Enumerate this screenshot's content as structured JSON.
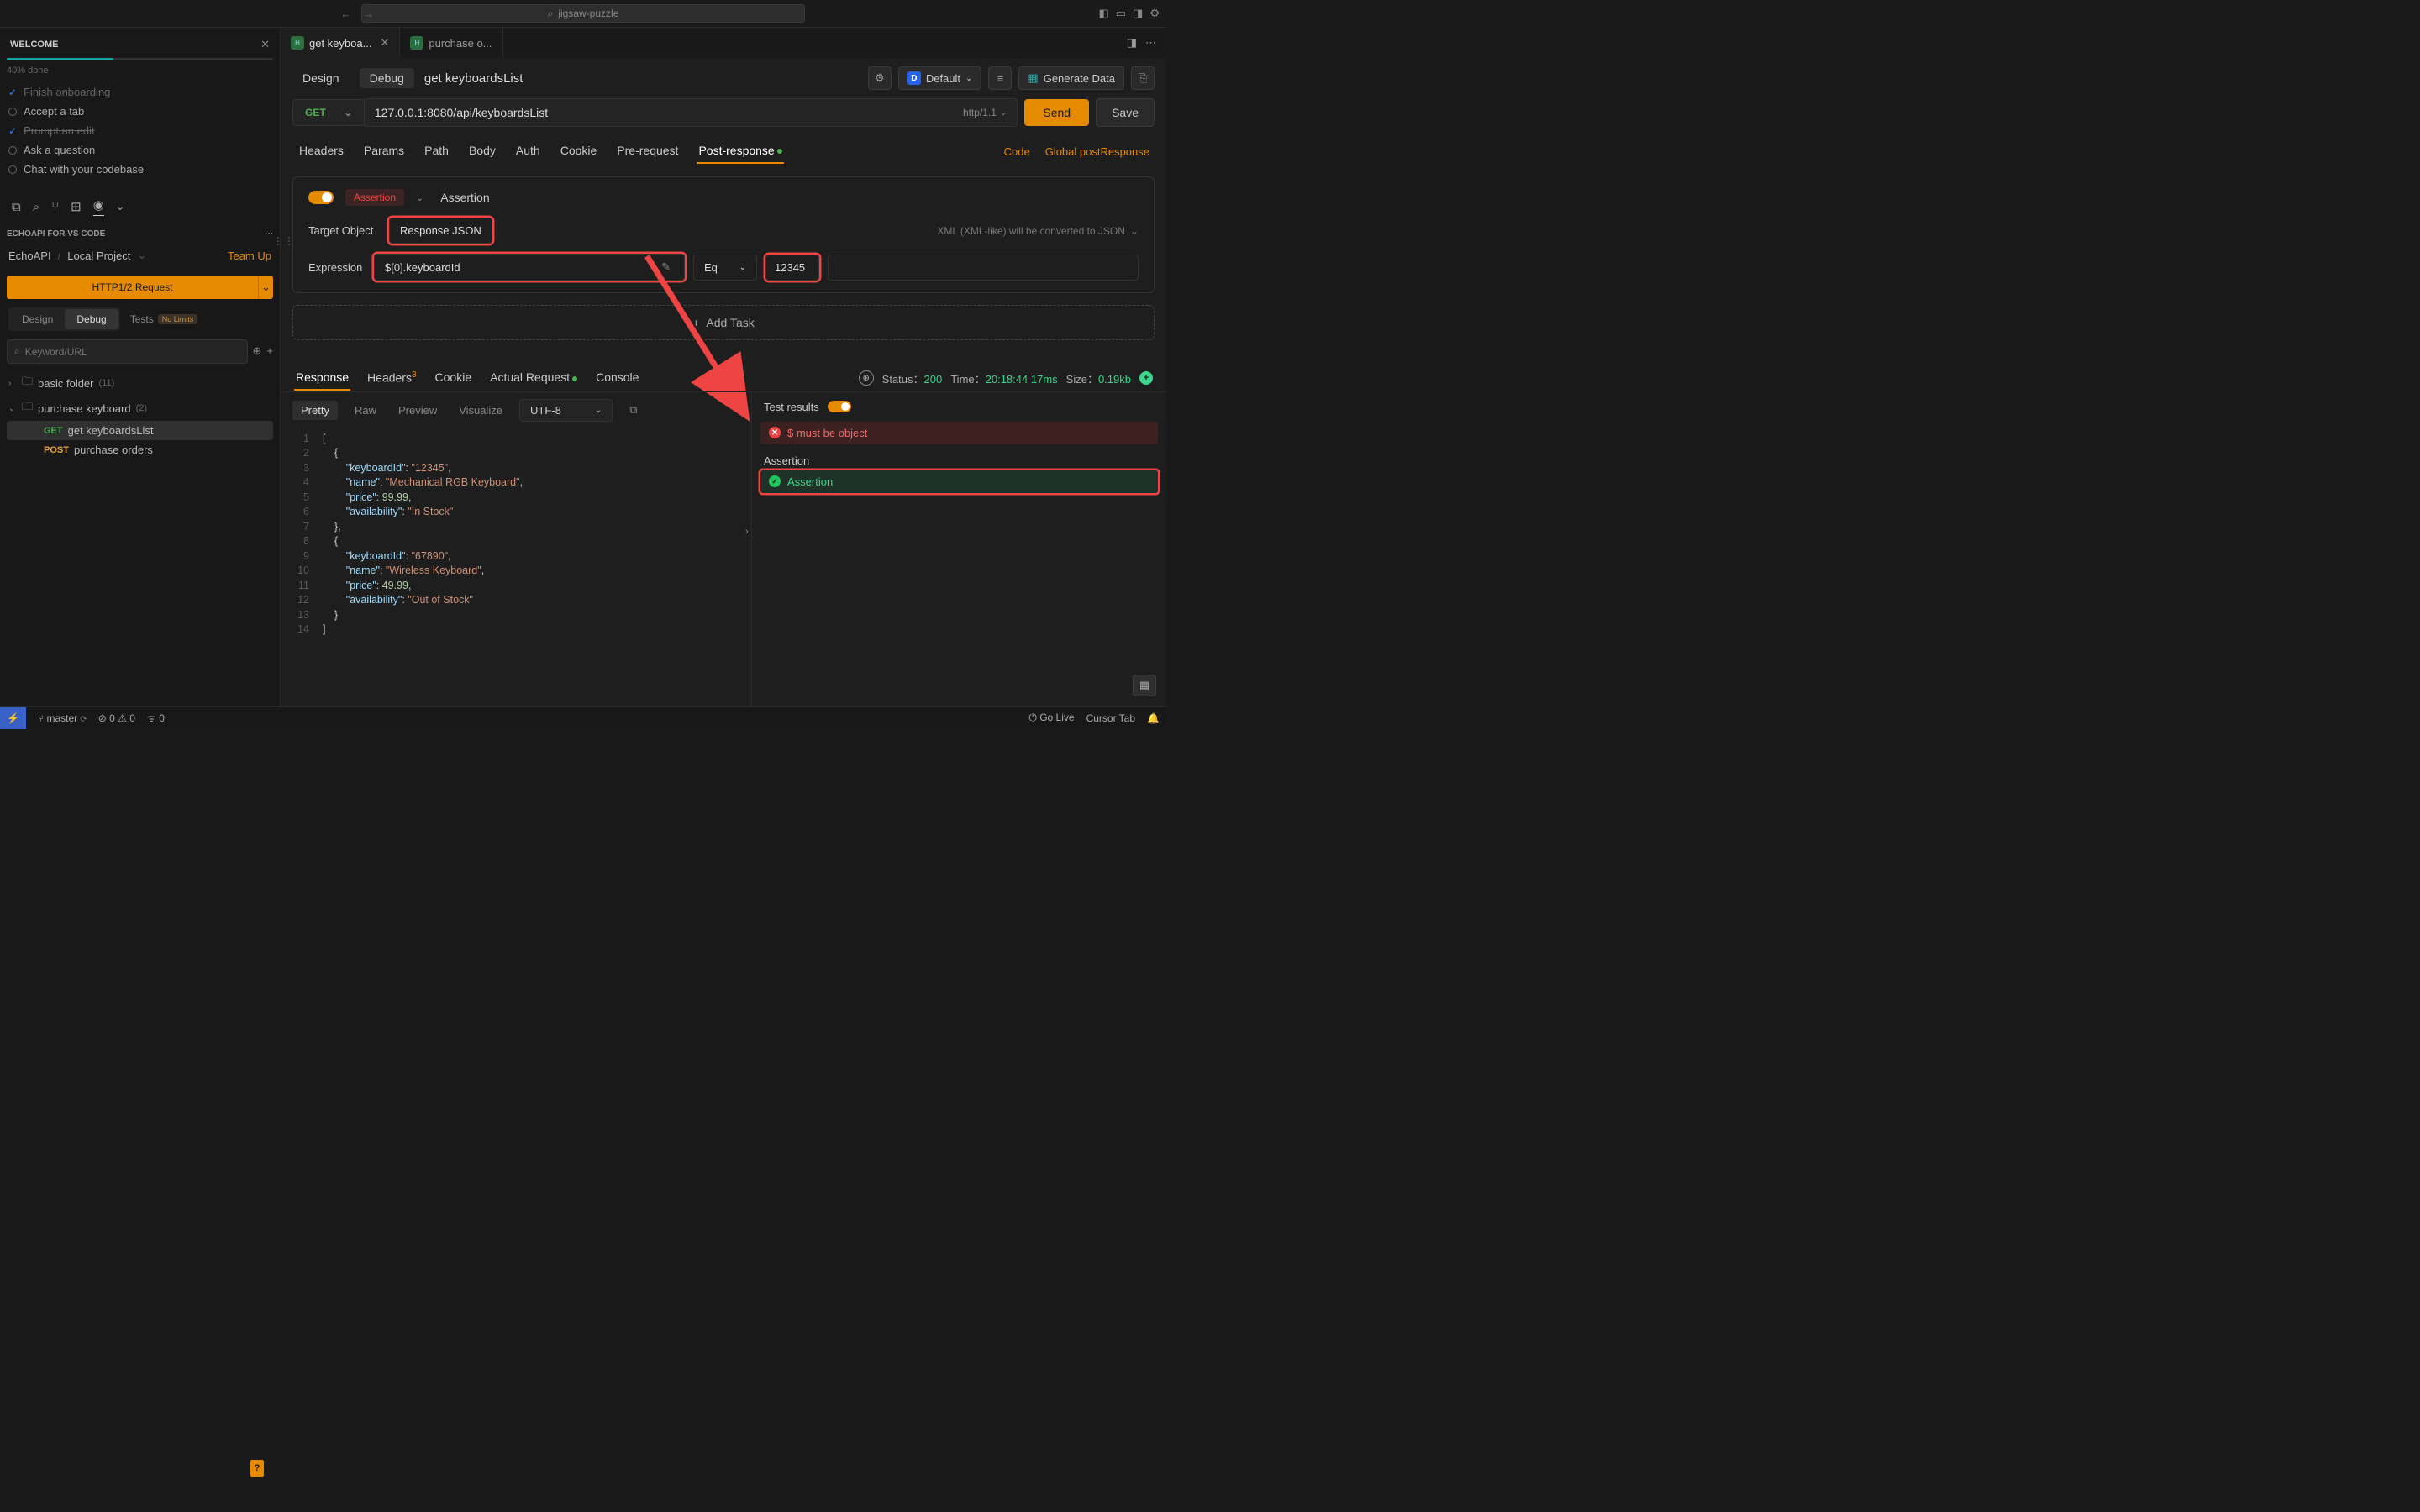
{
  "titlebar": {
    "search": "jigsaw-puzzle"
  },
  "welcome": {
    "title": "WELCOME",
    "pct_text": "40% done",
    "tasks": [
      {
        "label": "Finish onboarding",
        "done": true
      },
      {
        "label": "Accept a tab",
        "done": false
      },
      {
        "label": "Prompt an edit",
        "done": true
      },
      {
        "label": "Ask a question",
        "done": false
      },
      {
        "label": "Chat with your codebase",
        "done": false
      }
    ]
  },
  "extension": {
    "section": "ECHOAPI FOR VS CODE",
    "crumb_root": "EchoAPI",
    "crumb_proj": "Local Project",
    "team_up": "Team Up",
    "new_btn": "HTTP1/2 Request"
  },
  "modes": {
    "design": "Design",
    "debug": "Debug",
    "tests": "Tests",
    "nolimits": "No Limits"
  },
  "search_placeholder": "Keyword/URL",
  "tree": {
    "folder1": {
      "name": "basic folder",
      "count": "(11)"
    },
    "folder2": {
      "name": "purchase keyboard",
      "count": "(2)"
    },
    "item1": {
      "method": "GET",
      "name": "get keyboardsList"
    },
    "item2": {
      "method": "POST",
      "name": "purchase orders"
    }
  },
  "tabs": {
    "t1": "get keyboa...",
    "t2": "purchase o..."
  },
  "request": {
    "design": "Design",
    "debug": "Debug",
    "title": "get keyboardsList",
    "default_env": "Default",
    "gen_data": "Generate Data",
    "method": "GET",
    "url": "127.0.0.1:8080/api/keyboardsList",
    "httpver": "http/1.1",
    "send": "Send",
    "save": "Save"
  },
  "subtabs": {
    "headers": "Headers",
    "params": "Params",
    "path": "Path",
    "body": "Body",
    "auth": "Auth",
    "cookie": "Cookie",
    "pre": "Pre-request",
    "post": "Post-response",
    "code": "Code",
    "global": "Global postResponse"
  },
  "assertion": {
    "badge": "Assertion",
    "type_label": "Assertion",
    "target_lbl": "Target Object",
    "target_val": "Response JSON",
    "xml_note": "XML (XML-like) will be converted to JSON",
    "expr_lbl": "Expression",
    "expr_val": "$[0].keyboardId",
    "op": "Eq",
    "cmp_val": "12345",
    "add_task": "Add Task"
  },
  "response": {
    "tabs": {
      "response": "Response",
      "headers": "Headers",
      "hcount": "3",
      "cookie": "Cookie",
      "actual": "Actual Request",
      "console": "Console"
    },
    "status_lbl": "Status：",
    "status_val": "200",
    "time_lbl": "Time：",
    "time_val1": "20:18:44",
    "time_val2": "17ms",
    "size_lbl": "Size：",
    "size_val": "0.19kb",
    "pretty": "Pretty",
    "raw": "Raw",
    "preview": "Preview",
    "visualize": "Visualize",
    "encoding": "UTF-8"
  },
  "json_body": [
    {
      "keyboardId": "12345",
      "name": "Mechanical RGB Keyboard",
      "price": 99.99,
      "availability": "In Stock"
    },
    {
      "keyboardId": "67890",
      "name": "Wireless Keyboard",
      "price": 49.99,
      "availability": "Out of Stock"
    }
  ],
  "test_results": {
    "title": "Test results",
    "error": "$ must be object",
    "section": "Assertion",
    "pass": "Assertion"
  },
  "statusbar": {
    "branch": "master",
    "err": "0",
    "warn": "0",
    "port": "0",
    "golive": "Go Live",
    "cursor": "Cursor Tab"
  }
}
